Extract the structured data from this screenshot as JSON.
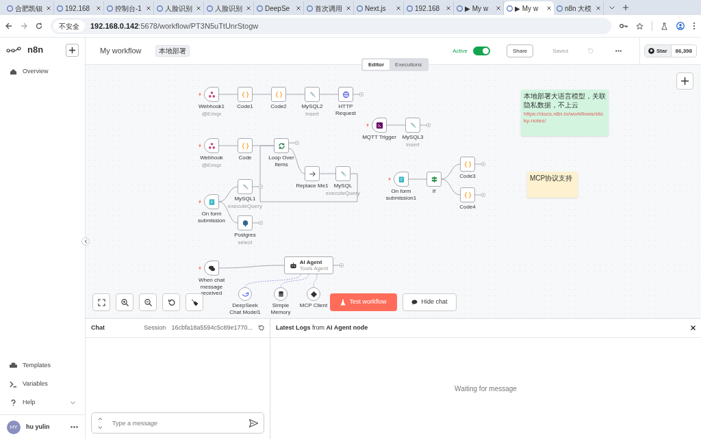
{
  "browser": {
    "tabs": [
      {
        "title": "合肥凯钡",
        "selected": false
      },
      {
        "title": "192.168",
        "selected": false
      },
      {
        "title": "控制台-1",
        "selected": false
      },
      {
        "title": "人脸识别",
        "selected": false
      },
      {
        "title": "人脸识别",
        "selected": false
      },
      {
        "title": "DeepSe",
        "selected": false
      },
      {
        "title": "首次调用",
        "selected": false
      },
      {
        "title": "Next.js",
        "selected": false
      },
      {
        "title": "192.168",
        "selected": false
      },
      {
        "title": "▶ My w",
        "selected": false
      },
      {
        "title": "▶ My w",
        "selected": true
      },
      {
        "title": "n8n 大模",
        "selected": false
      }
    ],
    "security_label": "不安全",
    "url_host": "192.168.0.142",
    "url_rest": ":5678/workflow/PT3N5uTtUnrStogw"
  },
  "sidebar": {
    "logo": "n8n",
    "top_items": [
      {
        "label": "Overview"
      }
    ],
    "bottom_items": [
      {
        "label": "Templates"
      },
      {
        "label": "Variables"
      },
      {
        "label": "Help"
      }
    ],
    "user": {
      "initials": "HY",
      "name": "hu yulin"
    }
  },
  "header": {
    "title": "My workflow",
    "tag": "本地部署",
    "active_label": "Active",
    "active": true,
    "share": "Share",
    "saved": "Saved",
    "star": "Star",
    "stars_count": "86,398"
  },
  "view_tabs": [
    {
      "label": "Editor",
      "selected": true
    },
    {
      "label": "Executions",
      "selected": false
    }
  ],
  "nodes": [
    {
      "label": "Webhook1",
      "subtitle": "@Emqx",
      "kind": "webhook",
      "trigger": true
    },
    {
      "label": "Code1",
      "kind": "code",
      "trigger": false
    },
    {
      "label": "Code2",
      "kind": "code",
      "trigger": false
    },
    {
      "label": "MySQL2",
      "subtitle": "insert",
      "kind": "mysql",
      "trigger": false
    },
    {
      "label": "HTTP Request",
      "kind": "http",
      "trigger": false
    },
    {
      "label": "MQTT Trigger",
      "kind": "mqtt",
      "trigger": true
    },
    {
      "label": "MySQL3",
      "subtitle": "insert",
      "kind": "mysql",
      "trigger": false
    },
    {
      "label": "Webhook",
      "subtitle": "@Emqx",
      "kind": "webhook",
      "trigger": true
    },
    {
      "label": "Code",
      "kind": "code",
      "trigger": false
    },
    {
      "label": "Loop Over Items",
      "kind": "loop",
      "trigger": false
    },
    {
      "label": "Replace Me1",
      "kind": "replace",
      "trigger": false
    },
    {
      "label": "MySQL",
      "subtitle": "executeQuery",
      "kind": "mysql",
      "trigger": false
    },
    {
      "label": "MySQL1",
      "subtitle": "executeQuery",
      "kind": "mysql",
      "trigger": false
    },
    {
      "label": "On form submission",
      "kind": "form",
      "trigger": true
    },
    {
      "label": "On form submission1",
      "kind": "form",
      "trigger": true
    },
    {
      "label": "If",
      "kind": "if",
      "trigger": false
    },
    {
      "label": "Code3",
      "kind": "code",
      "trigger": false
    },
    {
      "label": "Code4",
      "kind": "code",
      "trigger": false
    },
    {
      "label": "Postgres",
      "subtitle": "select",
      "kind": "postgres",
      "trigger": false
    },
    {
      "label": "When chat message received",
      "kind": "chat",
      "trigger": true
    },
    {
      "label": "AI Agent",
      "subtitle": "Tools Agent",
      "kind": "agent",
      "trigger": false
    },
    {
      "label": "DeepSeek Chat Model1",
      "kind": "model",
      "trigger": false
    },
    {
      "label": "Simple Memory",
      "kind": "memory",
      "trigger": false
    },
    {
      "label": "MCP Client",
      "kind": "mcp",
      "trigger": false
    }
  ],
  "sticky_notes": [
    {
      "title": "本地部署大语言模型，关联隐私数据，不上云",
      "link": "https://docs.n8n.io/workflows/sticky-notes/",
      "color": "#d3f5e0"
    },
    {
      "title": "MCP协议支持",
      "color": "#fdf1cf"
    }
  ],
  "canvas_buttons": {
    "test": "Test workflow",
    "hide_chat": "Hide chat"
  },
  "chat": {
    "title": "Chat",
    "session": "Session",
    "session_id": "16cbfa18a5594c5c89e1770...",
    "placeholder": "Type a message"
  },
  "logs": {
    "title": "**Latest Logs** from **AI Agent node**",
    "empty": "Waiting for message"
  }
}
